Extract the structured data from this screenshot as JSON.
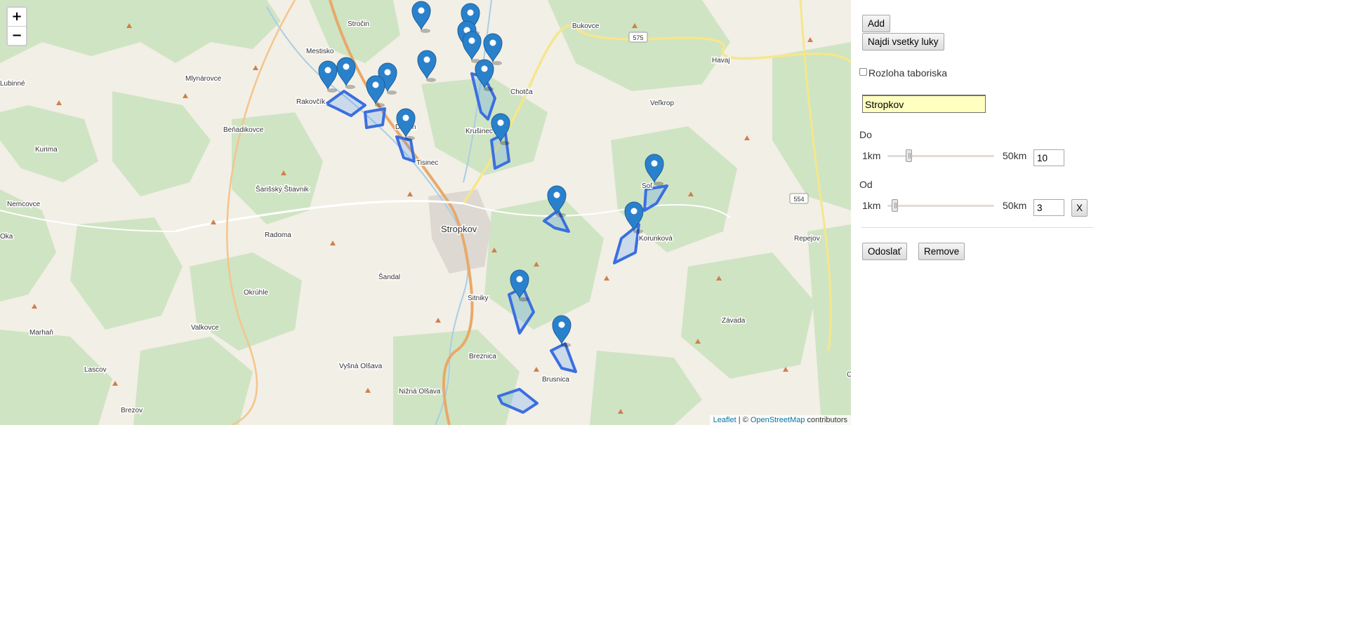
{
  "map": {
    "zoom_in": "+",
    "zoom_out": "−",
    "attribution": {
      "leaflet": "Leaflet",
      "separator": " | © ",
      "osm": "OpenStreetMap",
      "contributors": " contributors"
    },
    "places": [
      {
        "name": "Stročin"
      },
      {
        "name": "Bukovce"
      },
      {
        "name": "Mestisko"
      },
      {
        "name": "Havaj"
      },
      {
        "name": "Mlynárovce"
      },
      {
        "name": "Chotča"
      },
      {
        "name": "Lubinné"
      },
      {
        "name": "Rakovčík"
      },
      {
        "name": "Veľkrop"
      },
      {
        "name": "Beňadikovce"
      },
      {
        "name": "Dobrin"
      },
      {
        "name": "Krušinec"
      },
      {
        "name": "Kurima"
      },
      {
        "name": "Tisinec"
      },
      {
        "name": "Šarišský Štiavnik"
      },
      {
        "name": "Soľ"
      },
      {
        "name": "Nemcovce"
      },
      {
        "name": "Stropkov"
      },
      {
        "name": "Radoma"
      },
      {
        "name": "Korunková"
      },
      {
        "name": "Repejov"
      },
      {
        "name": "Šandal"
      },
      {
        "name": "Okrúhle"
      },
      {
        "name": "Sitniky"
      },
      {
        "name": "Marhaň"
      },
      {
        "name": "Valkovce"
      },
      {
        "name": "Závada"
      },
      {
        "name": "Breznica"
      },
      {
        "name": "Lascov"
      },
      {
        "name": "Vyšná Olšava"
      },
      {
        "name": "Brusnica"
      },
      {
        "name": "Nižná Olšava"
      },
      {
        "name": "Brezov"
      },
      {
        "name": "Oka"
      },
      {
        "name": "O"
      }
    ],
    "road_shields": [
      "575",
      "554"
    ],
    "marker_count": 18
  },
  "panel": {
    "add_button": "Add",
    "find_all_button": "Najdi vsetky luky",
    "checkbox_label": "Rozloha taboriska",
    "checkbox_checked": false,
    "city_input_value": "Stropkov",
    "do_label": "Do",
    "od_label": "Od",
    "min_label": "1km",
    "max_label": "50km",
    "do_value": "10",
    "od_value": "3",
    "do_slider_fraction": 0.18,
    "od_slider_fraction": 0.04,
    "clear_button": "X",
    "submit_button": "Odoslať",
    "remove_button": "Remove"
  }
}
